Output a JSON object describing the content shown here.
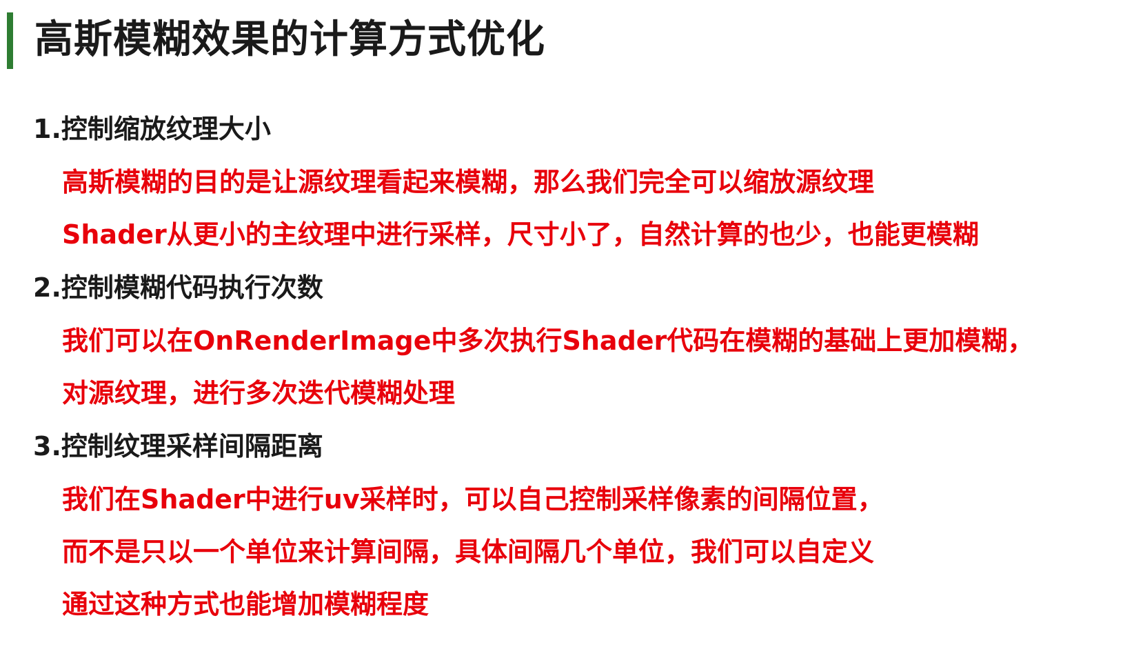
{
  "title": "高斯模糊效果的计算方式优化",
  "colors": {
    "accent_bar": "#2e7d32",
    "heading_text": "#1a1a1a",
    "body_text": "#e8000b"
  },
  "sections": [
    {
      "heading": "1.控制缩放纹理大小",
      "lines": [
        "高斯模糊的目的是让源纹理看起来模糊，那么我们完全可以缩放源纹理",
        "Shader从更小的主纹理中进行采样，尺寸小了，自然计算的也少，也能更模糊"
      ]
    },
    {
      "heading": "2.控制模糊代码执行次数",
      "lines": [
        "我们可以在OnRenderImage中多次执行Shader代码在模糊的基础上更加模糊，",
        "对源纹理，进行多次迭代模糊处理"
      ]
    },
    {
      "heading": "3.控制纹理采样间隔距离",
      "lines": [
        "我们在Shader中进行uv采样时，可以自己控制采样像素的间隔位置，",
        "而不是只以一个单位来计算间隔，具体间隔几个单位，我们可以自定义",
        "通过这种方式也能增加模糊程度"
      ]
    }
  ]
}
